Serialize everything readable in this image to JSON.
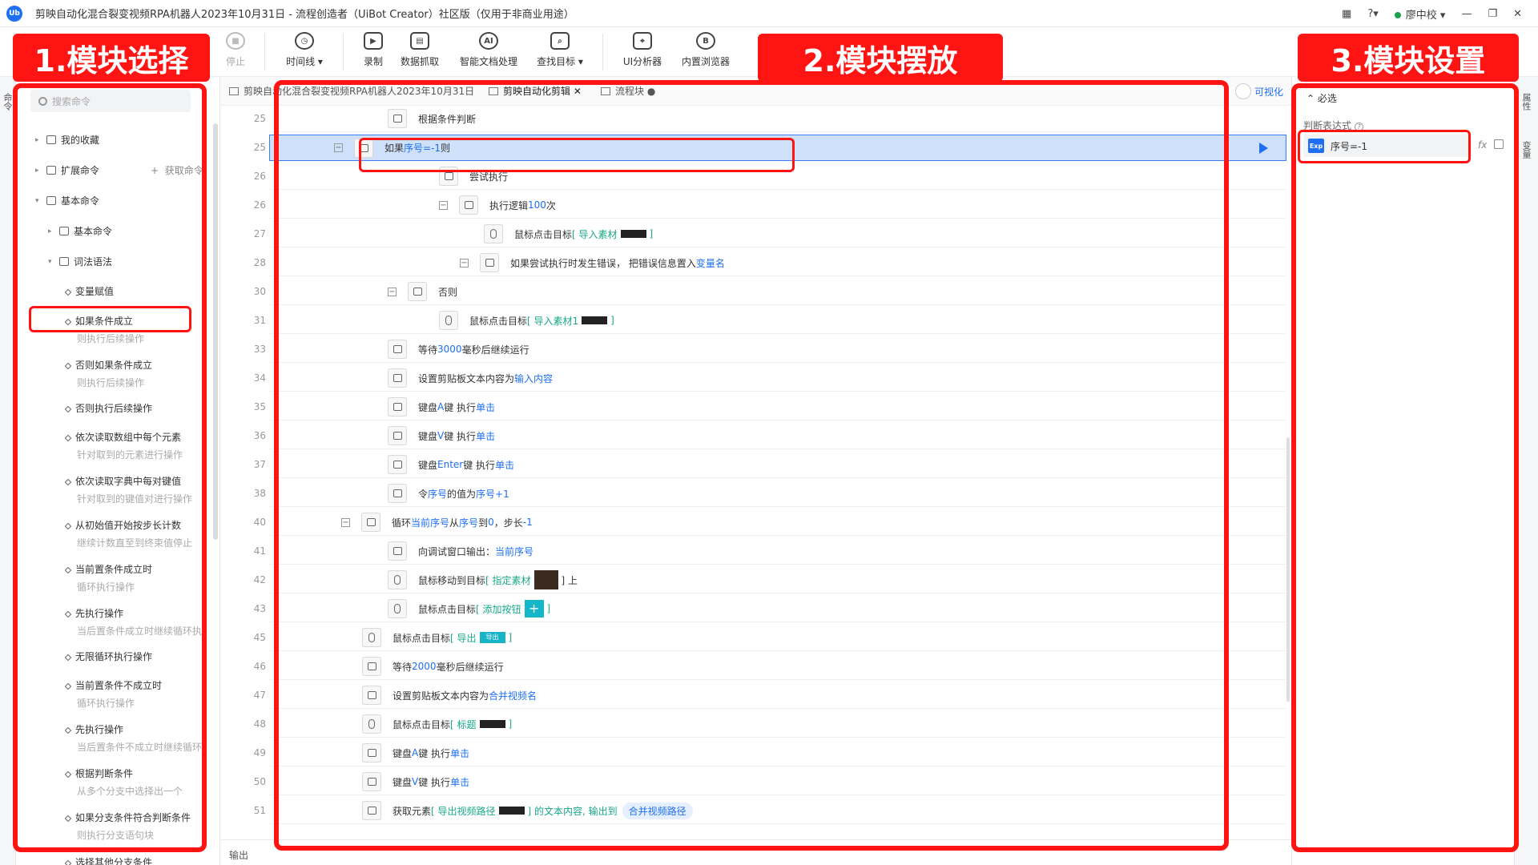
{
  "app": {
    "logo": "Ub",
    "title": "剪映自动化混合裂变视频RPA机器人2023年10月31日 - 流程创造者（UiBot Creator）社区版（仅用于非商业用途）",
    "user": "廖中校"
  },
  "toolbar": {
    "stop": "停止",
    "timeline": "时间线",
    "record": "录制",
    "data_scrape": "数据抓取",
    "smart_doc": "智能文档处理",
    "find_target": "查找目标",
    "ui_analyzer": "UI分析器",
    "builtin_browser": "内置浏览器"
  },
  "annotations": {
    "a1": "1.模块选择",
    "a2": "2.模块摆放",
    "a3": "3.模块设置"
  },
  "left": {
    "search_placeholder": "搜索命令",
    "favorites": "我的收藏",
    "extensions": "扩展命令",
    "get_cmd": "获取命令",
    "basic_cmds": "基本命令",
    "basic_sub": "基本命令",
    "syntax": "词法语法",
    "side_tab": "命令"
  },
  "commands": [
    {
      "name": "变量赋值",
      "sub": ""
    },
    {
      "name": "如果条件成立",
      "sub": "则执行后续操作"
    },
    {
      "name": "否则如果条件成立",
      "sub": "则执行后续操作"
    },
    {
      "name": "否则执行后续操作",
      "sub": ""
    },
    {
      "name": "依次读取数组中每个元素",
      "sub": "针对取到的元素进行操作"
    },
    {
      "name": "依次读取字典中每对键值",
      "sub": "针对取到的键值对进行操作"
    },
    {
      "name": "从初始值开始按步长计数",
      "sub": "继续计数直至到终束值停止"
    },
    {
      "name": "当前置条件成立时",
      "sub": "循环执行操作"
    },
    {
      "name": "先执行操作",
      "sub": "当后置条件成立时继续循环执行"
    },
    {
      "name": "无限循环执行操作",
      "sub": ""
    },
    {
      "name": "当前置条件不成立时",
      "sub": "循环执行操作"
    },
    {
      "name": "先执行操作",
      "sub": "当后置条件不成立时继续循环执行"
    },
    {
      "name": "根据判断条件",
      "sub": "从多个分支中选择出一个"
    },
    {
      "name": "如果分支条件符合判断条件",
      "sub": "则执行分支语句块"
    },
    {
      "name": "选择其他分支条件",
      "sub": ""
    }
  ],
  "editor": {
    "tab1": "剪映自动化混合裂变视频RPA机器人2023年10月31日",
    "tab2": "剪映自动化剪辑",
    "tab3": "流程块",
    "visualize": "可视化",
    "output": "输出",
    "line_numbers": [
      "25",
      "25",
      "26",
      "26",
      "27",
      "28",
      "30",
      "31",
      "33",
      "34",
      "35",
      "36",
      "37",
      "38",
      "40",
      "41",
      "42",
      "43",
      "45",
      "46",
      "47",
      "48",
      "49",
      "50",
      "51"
    ]
  },
  "code": {
    "r0": {
      "a": "根据条件判断"
    },
    "r1": {
      "a": "如果 ",
      "b": "序号=-1",
      "c": " 则"
    },
    "r2": {
      "a": "尝试执行"
    },
    "r3": {
      "a": "执行逻辑 ",
      "b": "100",
      "c": " 次"
    },
    "r4": {
      "a": "鼠标点击目标 ",
      "b": "[ 导入素材",
      "c": " ]"
    },
    "r5": {
      "a": "如果尝试执行时发生错误，  把错误信息置入 ",
      "b": "变量名"
    },
    "r6": {
      "a": "否则"
    },
    "r7": {
      "a": "鼠标点击目标 ",
      "b": "[ 导入素材1",
      "c": " ]"
    },
    "r8": {
      "a": "等待 ",
      "b": "3000",
      "c": " 毫秒后继续运行"
    },
    "r9": {
      "a": "设置剪贴板文本内容为 ",
      "b": "输入内容"
    },
    "r10": {
      "a": "键盘 ",
      "b": "A",
      "c": " 键 执行 ",
      "d": "单击"
    },
    "r11": {
      "a": "键盘 ",
      "b": "V",
      "c": " 键 执行 ",
      "d": "单击"
    },
    "r12": {
      "a": "键盘 ",
      "b": "Enter",
      "c": " 键 执行 ",
      "d": "单击"
    },
    "r13": {
      "a": "令 ",
      "b": "序号",
      "c": " 的值为 ",
      "d": "序号+1"
    },
    "r14": {
      "a": "循环 ",
      "b": "当前序号",
      "c": " 从 ",
      "d": "序号",
      "e": " 到 ",
      "f": "0",
      "g": " ，步长 ",
      "h": "-1"
    },
    "r15": {
      "a": "向调试窗口输出：  ",
      "b": "当前序号"
    },
    "r16": {
      "a": "鼠标移动到目标 ",
      "b": "[ 指定素材",
      "c": " ] 上"
    },
    "r17": {
      "a": "鼠标点击目标 ",
      "b": "[ 添加按钮",
      "c": " ]",
      "icon": "+"
    },
    "r18": {
      "a": "鼠标点击目标 ",
      "b": "[ 导出",
      "c": " ]",
      "thumb": "导出"
    },
    "r19": {
      "a": "等待 ",
      "b": "2000",
      "c": " 毫秒后继续运行"
    },
    "r20": {
      "a": "设置剪贴板文本内容为 ",
      "b": "合并视频名"
    },
    "r21": {
      "a": "鼠标点击目标 ",
      "b": "[ 标题",
      "c": " ]"
    },
    "r22": {
      "a": "键盘 ",
      "b": "A",
      "c": " 键 执行 ",
      "d": "单击"
    },
    "r23": {
      "a": "键盘 ",
      "b": "V",
      "c": " 键 执行 ",
      "d": "单击"
    },
    "r24": {
      "a": "获取元素 ",
      "b": "[ 导出视频路径",
      "c": " ] 的文本内容, 输出到 ",
      "d": "合并视频路径"
    }
  },
  "right": {
    "required": "必选",
    "label": "判断表达式",
    "badge": "Exp",
    "expr": "序号=-1",
    "fx": "fx",
    "side_tab1": "属性",
    "side_tab2": "变量"
  }
}
